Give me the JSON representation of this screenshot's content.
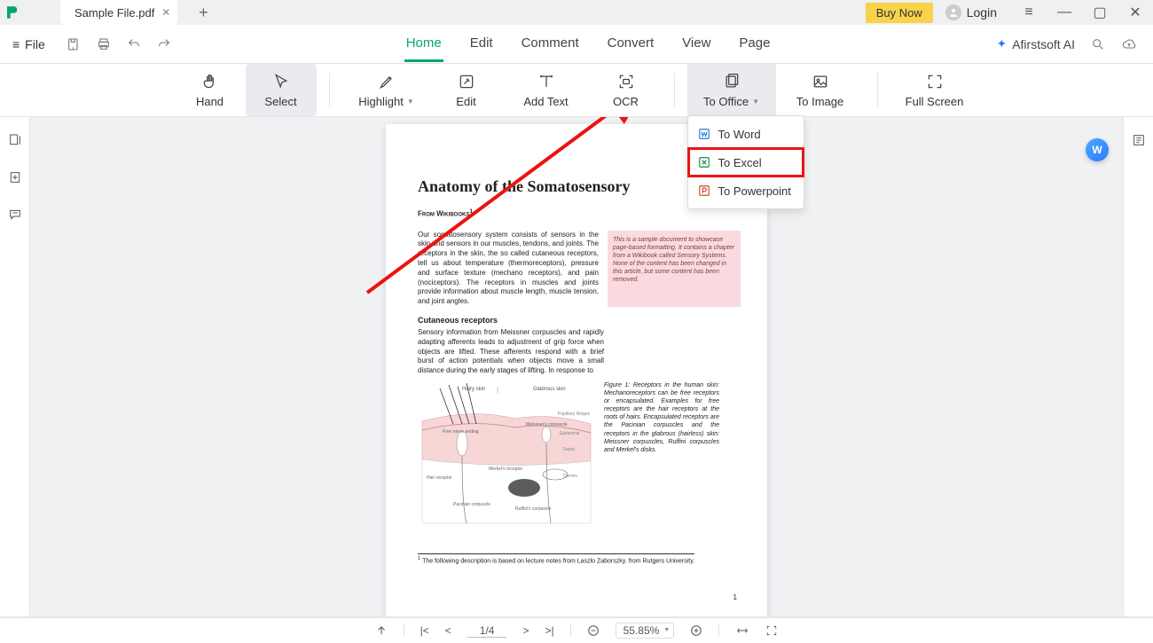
{
  "titlebar": {
    "tab_name": "Sample File.pdf",
    "buy_now": "Buy Now",
    "login": "Login"
  },
  "menubar": {
    "file": "File",
    "items": [
      "Home",
      "Edit",
      "Comment",
      "Convert",
      "View",
      "Page"
    ],
    "active_index": 0,
    "ai": "Afirstsoft AI"
  },
  "toolbar": {
    "items": [
      {
        "label": "Hand",
        "dropdown": false,
        "id": "hand"
      },
      {
        "label": "Select",
        "dropdown": false,
        "id": "select",
        "selected": true
      },
      {
        "label": "Highlight",
        "dropdown": true,
        "id": "highlight"
      },
      {
        "label": "Edit",
        "dropdown": false,
        "id": "edit"
      },
      {
        "label": "Add Text",
        "dropdown": false,
        "id": "addtext"
      },
      {
        "label": "OCR",
        "dropdown": false,
        "id": "ocr"
      },
      {
        "label": "To Office",
        "dropdown": true,
        "id": "tooffice",
        "active": true
      },
      {
        "label": "To Image",
        "dropdown": false,
        "id": "toimage"
      },
      {
        "label": "Full Screen",
        "dropdown": false,
        "id": "fullscreen"
      }
    ]
  },
  "dropdown": {
    "items": [
      {
        "label": "To Word",
        "hl": false
      },
      {
        "label": "To Excel",
        "hl": true
      },
      {
        "label": "To Powerpoint",
        "hl": false
      }
    ]
  },
  "document": {
    "title": "Anatomy of the Somatosensory",
    "from": "From Wikibooks",
    "para1": "Our somatosensory system consists of sensors in the skin and sensors in our muscles, tendons, and joints. The receptors in the skin, the so called cutaneous receptors, tell us about temperature (thermoreceptors), pressure and surface texture (mechano receptors), and pain (nociceptors). The receptors in muscles and joints provide information about muscle length, muscle tension, and joint angles.",
    "note": "This is a sample document to showcase page-based formatting. It contains a chapter from a Wikibook called Sensory Systems. None of the content has been changed in this article, but some content has been removed.",
    "sub1": "Cutaneous receptors",
    "para2": "Sensory information from Meissner corpuscles and rapidly adapting afferents leads to adjustment of grip force when objects are lifted. These afferents respond with a brief burst of action potentials when objects move a small distance during the early stages of lifting. In response to",
    "figcap": "Figure 1: Receptors in the human skin: Mechanoreceptors can be free receptors or encapsulated. Examples for free receptors are the hair receptors at the roots of hairs. Encapsulated receptors are the Pacinian corpuscles and the receptors in the glabrous (hairless) skin: Meissner corpuscles, Ruffini corpuscles and Merkel's disks.",
    "footnote": "The following description is based on lecture notes from Laszlo Zaborszky, from Rutgers University.",
    "pagenum": "1",
    "fig_labels": {
      "hairy": "Hairy skin",
      "glab": "Glabrous skin",
      "pap": "Papillary Ridges",
      "epi": "Epidermis",
      "sept": "Septa",
      "derm": "Dermis",
      "free": "Free nerve ending",
      "meiss": "Meissner's corpuscle",
      "hair": "Hair receptor",
      "merk": "Merkel's receptor",
      "pac": "Pacinian corpuscle",
      "ruf": "Ruffini's corpuscle"
    }
  },
  "statusbar": {
    "page": "1/4",
    "zoom": "55.85%"
  }
}
